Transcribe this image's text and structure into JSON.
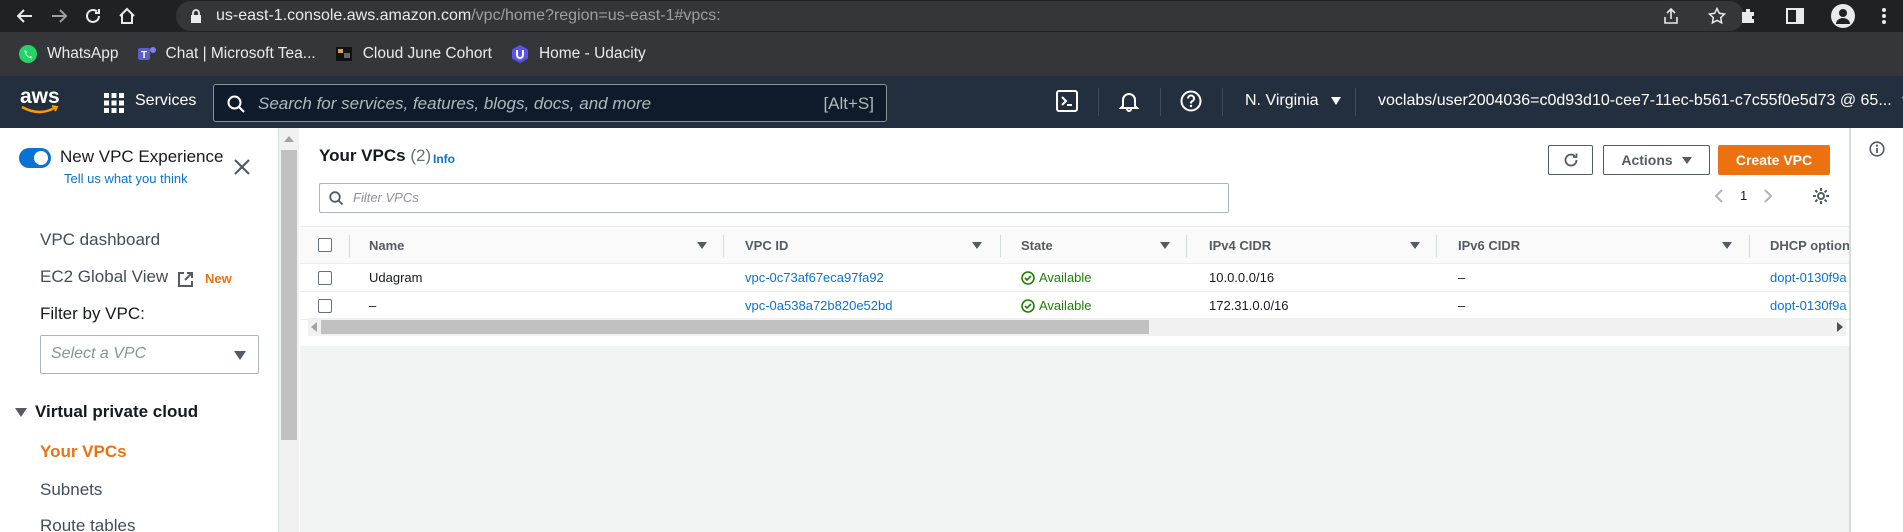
{
  "browser": {
    "url_host": "us-east-1.console.aws.amazon.com",
    "url_path": "/vpc/home?region=us-east-1#vpcs:",
    "bookmarks": [
      {
        "label": "WhatsApp",
        "icon": "whatsapp-icon"
      },
      {
        "label": "Chat | Microsoft Tea...",
        "icon": "teams-icon"
      },
      {
        "label": "Cloud June Cohort",
        "icon": "bookmark-icon"
      },
      {
        "label": "Home - Udacity",
        "icon": "udacity-icon"
      }
    ]
  },
  "aws_nav": {
    "logo": "aws",
    "services_label": "Services",
    "search_placeholder": "Search for services, features, blogs, docs, and more",
    "search_shortcut": "[Alt+S]",
    "region": "N. Virginia",
    "account": "voclabs/user2004036=c0d93d10-cee7-11ec-b561-c7c55f0e5d73 @ 65..."
  },
  "sidebar": {
    "toggle_label": "New VPC Experience",
    "tell_us": "Tell us what you think",
    "vpc_dashboard": "VPC dashboard",
    "ec2_global_view": "EC2 Global View",
    "new_badge": "New",
    "filter_label": "Filter by VPC:",
    "filter_placeholder": "Select a VPC",
    "section_title": "Virtual private cloud",
    "items": [
      {
        "label": "Your VPCs",
        "active": true
      },
      {
        "label": "Subnets",
        "active": false
      },
      {
        "label": "Route tables",
        "active": false
      }
    ]
  },
  "main": {
    "title": "Your VPCs",
    "count": "(2)",
    "info": "Info",
    "actions_label": "Actions",
    "create_label": "Create VPC",
    "filter_placeholder": "Filter VPCs",
    "page_number": "1",
    "columns": [
      "Name",
      "VPC ID",
      "State",
      "IPv4 CIDR",
      "IPv6 CIDR",
      "DHCP option"
    ],
    "rows": [
      {
        "name": "Udagram",
        "vpc_id": "vpc-0c73af67eca97fa92",
        "state": "Available",
        "ipv4": "10.0.0.0/16",
        "ipv6": "–",
        "dhcp": "dopt-0130f9a"
      },
      {
        "name": "–",
        "vpc_id": "vpc-0a538a72b820e52bd",
        "state": "Available",
        "ipv4": "172.31.0.0/16",
        "ipv6": "–",
        "dhcp": "dopt-0130f9a"
      }
    ]
  },
  "colors": {
    "aws_nav_bg": "#232f3e",
    "accent_orange": "#ec7211",
    "link_blue": "#0972d3",
    "success_green": "#1d8102"
  }
}
